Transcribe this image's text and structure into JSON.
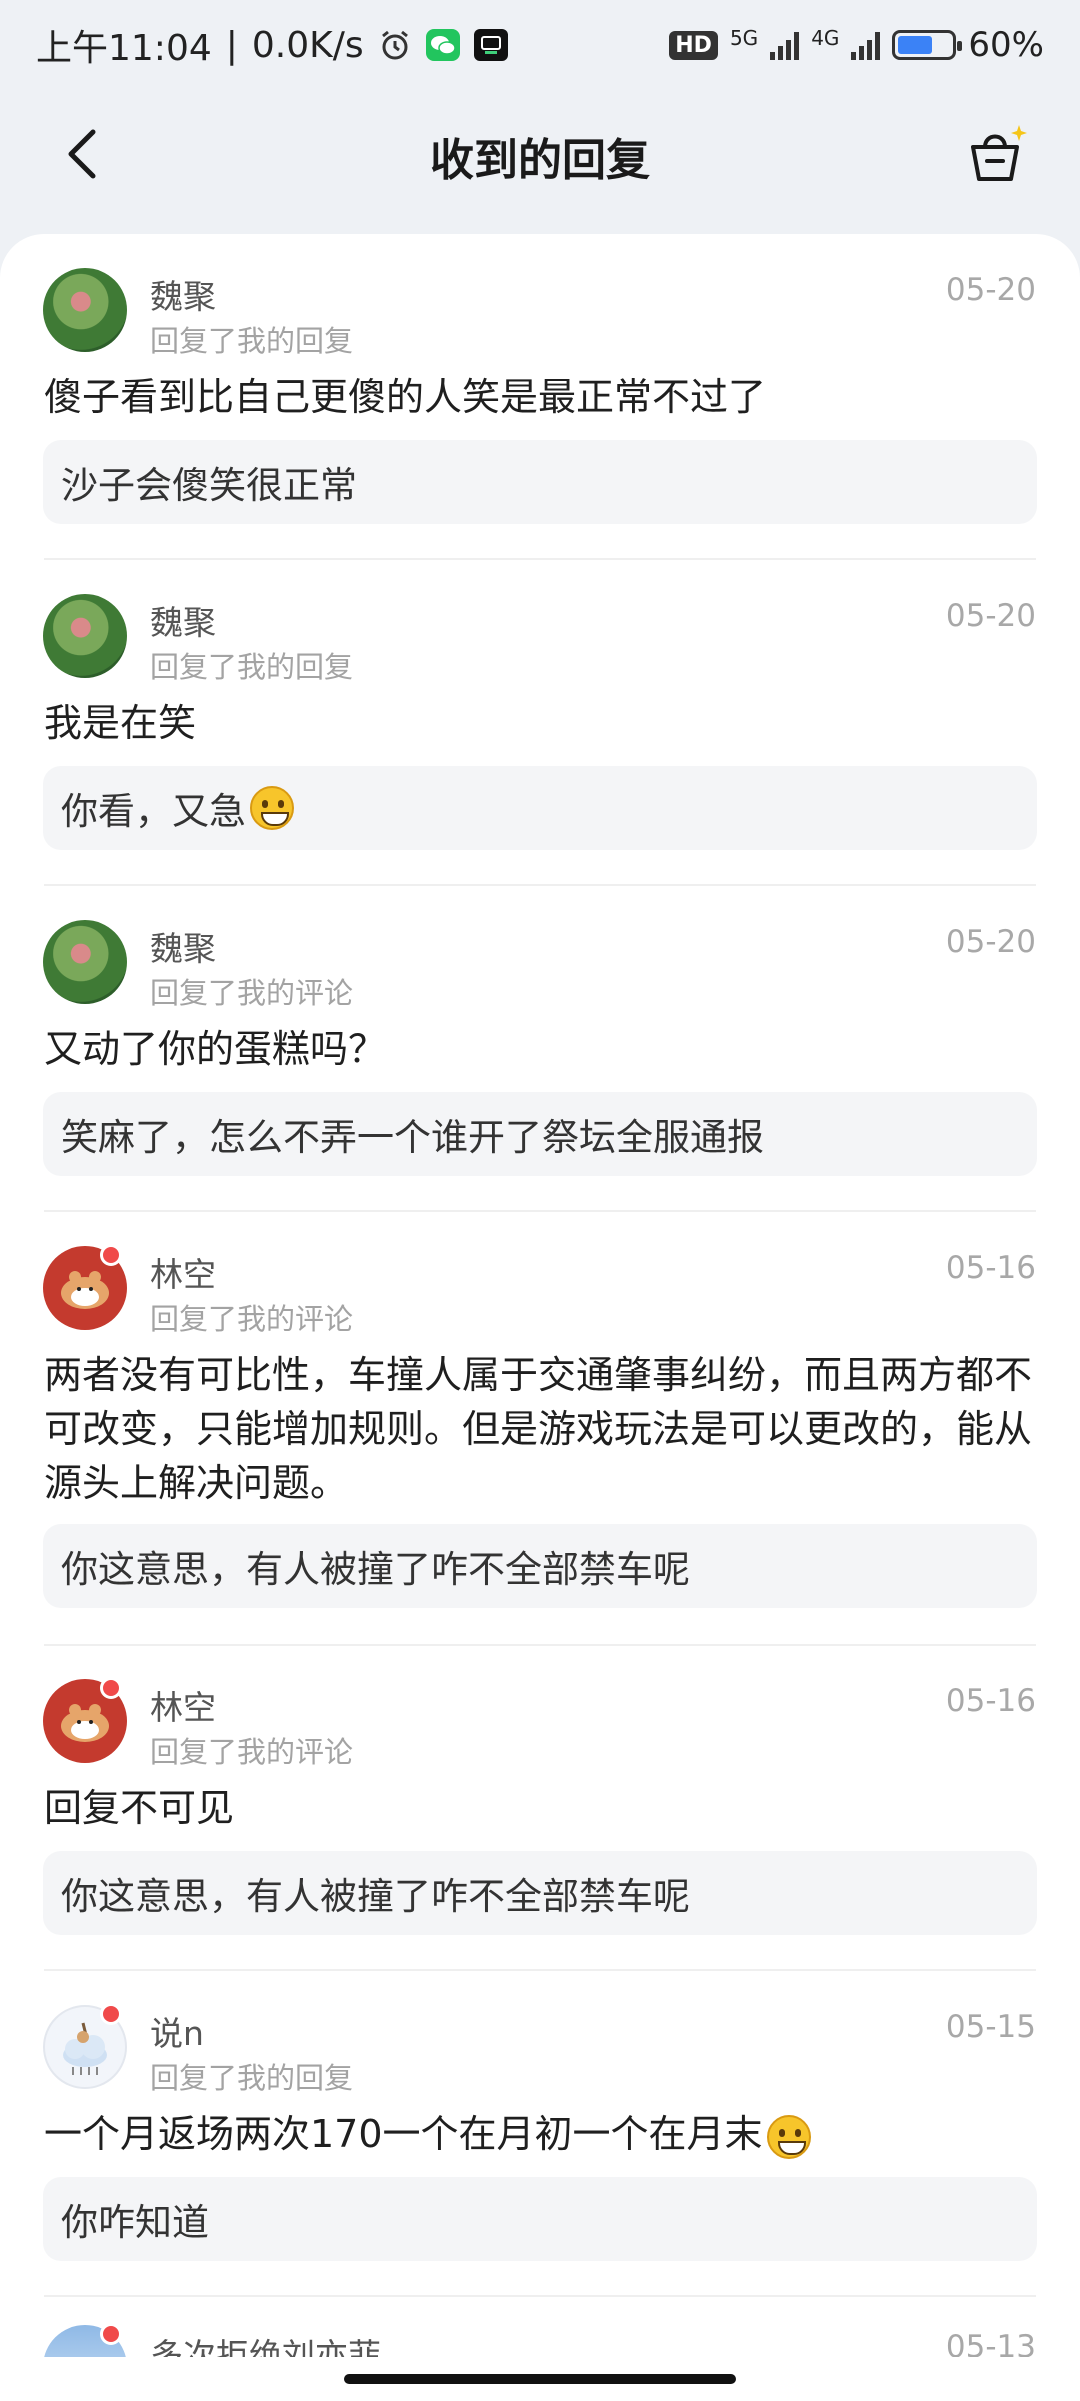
{
  "status_bar": {
    "time": "上午11:04",
    "speed": "0.0K/s",
    "hd": "HD",
    "net1": "5G",
    "net2": "4G",
    "battery": "60%"
  },
  "header": {
    "title": "收到的回复",
    "back_icon": "chevron-left-icon",
    "basket_icon": "basket-sparkle-icon"
  },
  "replies": [
    {
      "name": "魏聚",
      "sub": "回复了我的回复",
      "date": "05-20",
      "body": "傻子看到比自己更傻的人笑是最正常不过了",
      "quote": "沙子会傻笑很正常"
    },
    {
      "name": "魏聚",
      "sub": "回复了我的回复",
      "date": "05-20",
      "body": "我是在笑",
      "quote": "你看，又急"
    },
    {
      "name": "魏聚",
      "sub": "回复了我的评论",
      "date": "05-20",
      "body": "又动了你的蛋糕吗？",
      "quote": "笑麻了，怎么不弄一个谁开了祭坛全服通报"
    },
    {
      "name": "林空",
      "sub": "回复了我的评论",
      "date": "05-16",
      "body": "两者没有可比性，车撞人属于交通肇事纠纷，而且两方都不可改变，只能增加规则。但是游戏玩法是可以更改的，能从源头上解决问题。",
      "quote": "你这意思，有人被撞了咋不全部禁车呢"
    },
    {
      "name": "林空",
      "sub": "回复了我的评论",
      "date": "05-16",
      "body": "回复不可见",
      "quote": "你这意思，有人被撞了咋不全部禁车呢"
    },
    {
      "name": "说n",
      "sub": "回复了我的回复",
      "date": "05-15",
      "body": "一个月返场两次170一个在月初一个在月末",
      "quote": "你咋知道"
    },
    {
      "name": "多次拒绝刘亦菲",
      "date": "05-13"
    }
  ]
}
